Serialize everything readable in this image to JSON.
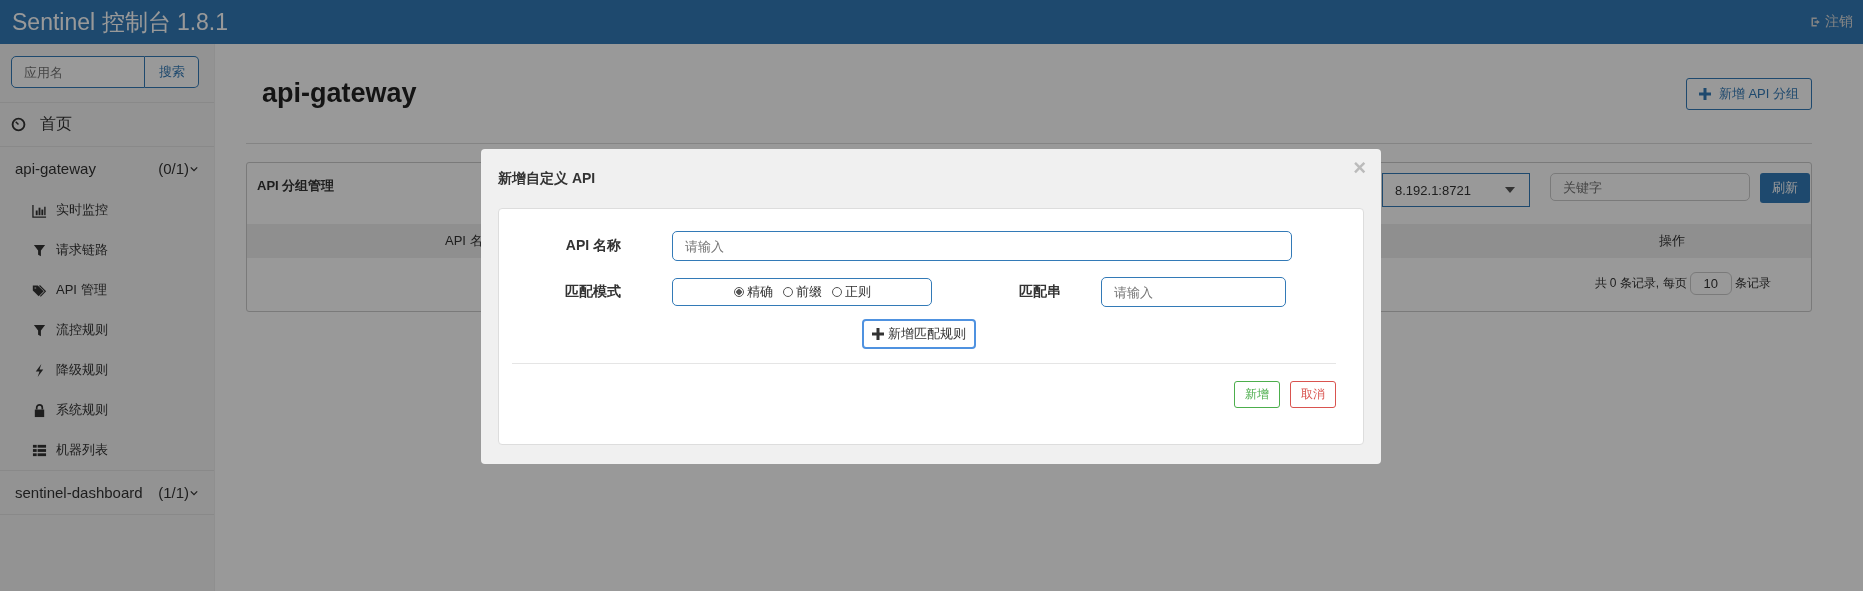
{
  "header": {
    "title": "Sentinel 控制台 1.8.1",
    "logout": "注销"
  },
  "sidebar": {
    "search_placeholder": "应用名",
    "search_button": "搜索",
    "home": "首页",
    "apps": [
      {
        "name": "api-gateway",
        "count": "(0/1)",
        "expanded": true,
        "children": [
          {
            "label": "实时监控",
            "kind": "chart"
          },
          {
            "label": "请求链路",
            "kind": "filter"
          },
          {
            "label": "API 管理",
            "kind": "tags"
          },
          {
            "label": "流控规则",
            "kind": "filter"
          },
          {
            "label": "降级规则",
            "kind": "bolt"
          },
          {
            "label": "系统规则",
            "kind": "lock"
          },
          {
            "label": "机器列表",
            "kind": "list"
          }
        ]
      },
      {
        "name": "sentinel-dashboard",
        "count": "(1/1)",
        "expanded": false
      }
    ]
  },
  "page": {
    "title": "api-gateway",
    "add_button": "新增 API 分组"
  },
  "panel": {
    "title": "API 分组管理",
    "machine": "8.192.1:8721",
    "keyword_placeholder": "关键字",
    "refresh": "刷新",
    "columns": [
      "API 名",
      "操作"
    ],
    "footer": {
      "before": "共 0 条记录, 每页",
      "page_size": "10",
      "after": "条记录"
    }
  },
  "modal": {
    "title": "新增自定义 API",
    "close": "×",
    "name_label": "API 名称",
    "name_placeholder": "请输入",
    "mode_label": "匹配模式",
    "modes": [
      {
        "label": "精确",
        "selected": true
      },
      {
        "label": "前缀",
        "selected": false
      },
      {
        "label": "正则",
        "selected": false
      }
    ],
    "pattern_label": "匹配串",
    "pattern_placeholder": "请输入",
    "add_rule": "新增匹配规则",
    "submit": "新增",
    "cancel": "取消"
  }
}
